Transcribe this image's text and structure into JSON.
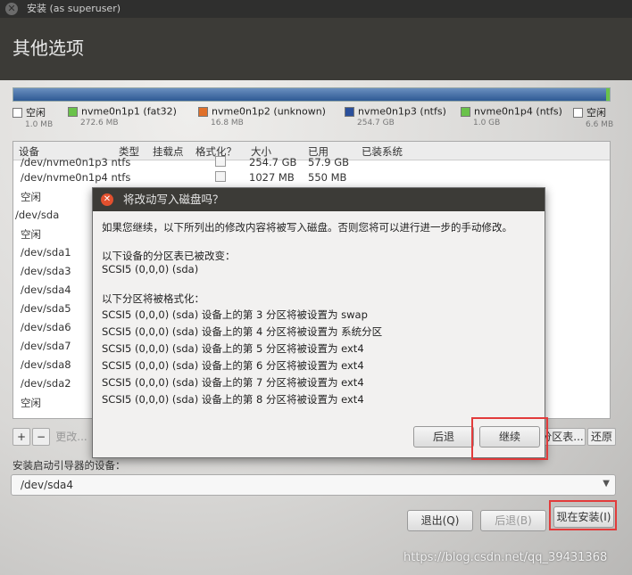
{
  "window": {
    "title": "安装 (as superuser)",
    "header": "其他选项"
  },
  "legend": [
    {
      "name": "空闲",
      "size": "1.0 MB",
      "color": "#ffffff"
    },
    {
      "name": "nvme0n1p1 (fat32)",
      "size": "272.6 MB",
      "color": "#6ac24a"
    },
    {
      "name": "nvme0n1p2 (unknown)",
      "size": "16.8 MB",
      "color": "#e0702a"
    },
    {
      "name": "nvme0n1p3 (ntfs)",
      "size": "254.7 GB",
      "color": "#2a4f9b"
    },
    {
      "name": "nvme0n1p4 (ntfs)",
      "size": "1.0 GB",
      "color": "#6ac24a"
    },
    {
      "name": "空闲",
      "size": "6.6 MB",
      "color": "#ffffff"
    }
  ],
  "table": {
    "headers": [
      "设备",
      "类型",
      "挂载点",
      "格式化？",
      "大小",
      "已用",
      "已装系统"
    ],
    "rows": [
      {
        "device": "/dev/nvme0n1p3  ntfs",
        "size": "254.7 GB",
        "used": "57.9 GB",
        "partial": true
      },
      {
        "device": "/dev/nvme0n1p4  ntfs",
        "size": "1027 MB",
        "used": "550 MB"
      },
      {
        "device": "空闲"
      },
      {
        "device": "/dev/sda",
        "top": true
      },
      {
        "device": "空闲"
      },
      {
        "device": "/dev/sda1"
      },
      {
        "device": "/dev/sda3"
      },
      {
        "device": "/dev/sda4"
      },
      {
        "device": "/dev/sda5"
      },
      {
        "device": "/dev/sda6"
      },
      {
        "device": "/dev/sda7"
      },
      {
        "device": "/dev/sda8"
      },
      {
        "device": "/dev/sda2"
      },
      {
        "device": "空闲"
      }
    ]
  },
  "table_buttons": {
    "add": "+",
    "remove": "−",
    "change": "更改...",
    "new_table": "分区表...",
    "revert": "还原"
  },
  "bootloader": {
    "label": "安装启动引导器的设备：",
    "value": "/dev/sda4"
  },
  "footer": {
    "quit": "退出(Q)",
    "back": "后退(B)",
    "install_now": "现在安装(I)"
  },
  "dialog": {
    "title": "将改动写入磁盘吗？",
    "intro": "如果您继续，以下所列出的修改内容将被写入磁盘。否则您将可以进行进一步的手动修改。",
    "changed_heading": "以下设备的分区表已被改变：",
    "changed_device": "SCSI5 (0,0,0) (sda)",
    "format_heading": "以下分区将被格式化：",
    "format_lines": [
      "SCSI5 (0,0,0) (sda) 设备上的第 3 分区将被设置为 swap",
      "SCSI5 (0,0,0) (sda) 设备上的第 4 分区将被设置为 系统分区",
      "SCSI5 (0,0,0) (sda) 设备上的第 5 分区将被设置为 ext4",
      "SCSI5 (0,0,0) (sda) 设备上的第 6 分区将被设置为 ext4",
      "SCSI5 (0,0,0) (sda) 设备上的第 7 分区将被设置为 ext4",
      "SCSI5 (0,0,0) (sda) 设备上的第 8 分区将被设置为 ext4"
    ],
    "back": "后退",
    "continue": "继续"
  },
  "watermark": "https://blog.csdn.net/qq_39431368"
}
